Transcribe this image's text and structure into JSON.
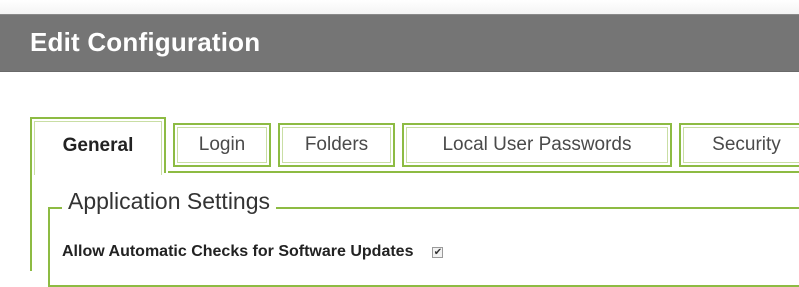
{
  "dialog": {
    "title": "Edit Configuration"
  },
  "tabs": [
    {
      "label": "General",
      "active": true
    },
    {
      "label": "Login",
      "active": false
    },
    {
      "label": "Folders",
      "active": false
    },
    {
      "label": "Local User Passwords",
      "active": false
    },
    {
      "label": "Security",
      "active": false
    }
  ],
  "application_settings": {
    "legend": "Application Settings",
    "allow_auto_updates": {
      "label": "Allow Automatic Checks for Software Updates",
      "checked": true,
      "check_glyph": "✔"
    }
  },
  "colors": {
    "header_bg": "#757575",
    "tab_border": "#8dbb43"
  }
}
